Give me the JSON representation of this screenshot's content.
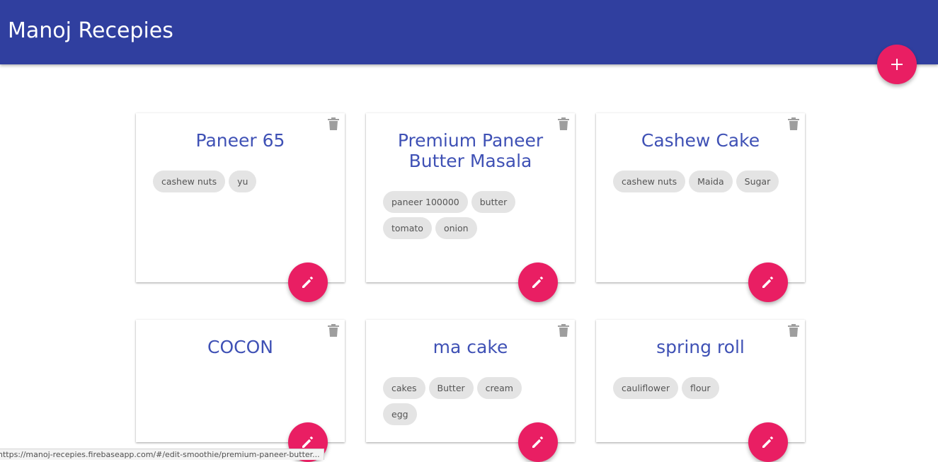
{
  "app": {
    "title": "Manoj Recepies"
  },
  "icons": {
    "add": "plus-icon",
    "delete": "trash-icon",
    "edit": "pencil-icon"
  },
  "colors": {
    "header": "#303f9f",
    "accent": "#e91e63",
    "card_title": "#3f51b5",
    "chip_bg": "#e4e4e4"
  },
  "recipes": [
    {
      "title": "Paneer 65",
      "ingredients": [
        "cashew nuts",
        "yu"
      ]
    },
    {
      "title": "Premium Paneer Butter Masala",
      "ingredients": [
        "paneer 100000",
        "butter",
        "tomato",
        "onion"
      ]
    },
    {
      "title": "Cashew Cake",
      "ingredients": [
        "cashew nuts",
        "Maida",
        "Sugar"
      ]
    },
    {
      "title": "COCON",
      "ingredients": []
    },
    {
      "title": "ma cake",
      "ingredients": [
        "cakes",
        "Butter",
        "cream",
        "egg"
      ]
    },
    {
      "title": "spring roll",
      "ingredients": [
        "cauliflower",
        "flour"
      ]
    }
  ],
  "status_bar": {
    "url": "https://manoj-recepies.firebaseapp.com/#/edit-smoothie/premium-paneer-butter..."
  }
}
